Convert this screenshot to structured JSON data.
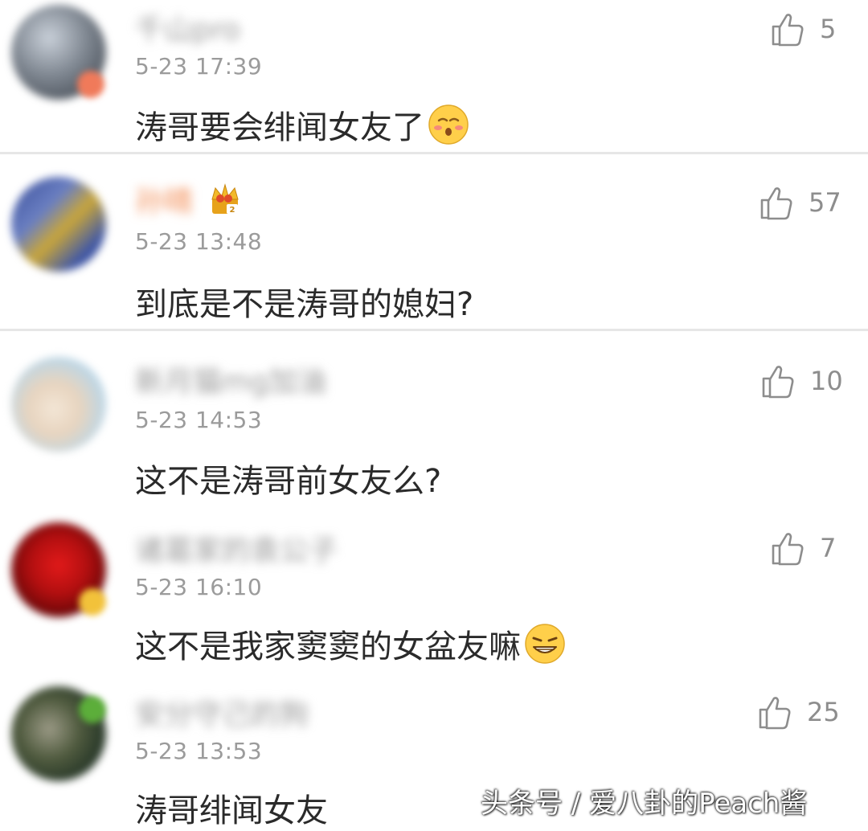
{
  "comments": [
    {
      "username": "千山pro",
      "timestamp": "5-23 17:39",
      "text": "涛哥要会绯闻女友了",
      "emoji": "blush-emoji",
      "likes": "5"
    },
    {
      "username": "孙晴",
      "timestamp": "5-23 13:48",
      "text": "到底是不是涛哥的媳妇?",
      "likes": "57",
      "badge": "vip-crown-icon"
    },
    {
      "username": "新月猫mg加油",
      "timestamp": "5-23 14:53",
      "text": "这不是涛哥前女友么?",
      "likes": "10"
    },
    {
      "username": "诸葛家的袁公子",
      "timestamp": "5-23 16:10",
      "text": "这不是我家窦窦的女盆友嘛",
      "emoji": "grin-emoji",
      "likes": "7"
    },
    {
      "username": "安分守己的狗",
      "timestamp": "5-23 13:53",
      "text": "涛哥绯闻女友",
      "likes": "25"
    }
  ],
  "watermark": "头条号 / 爱八卦的Peach酱",
  "colors": {
    "text": "#2a2a2a",
    "meta": "#9b9b9b",
    "divider": "#e6e6e6",
    "highlight_name": "#f3905a"
  }
}
